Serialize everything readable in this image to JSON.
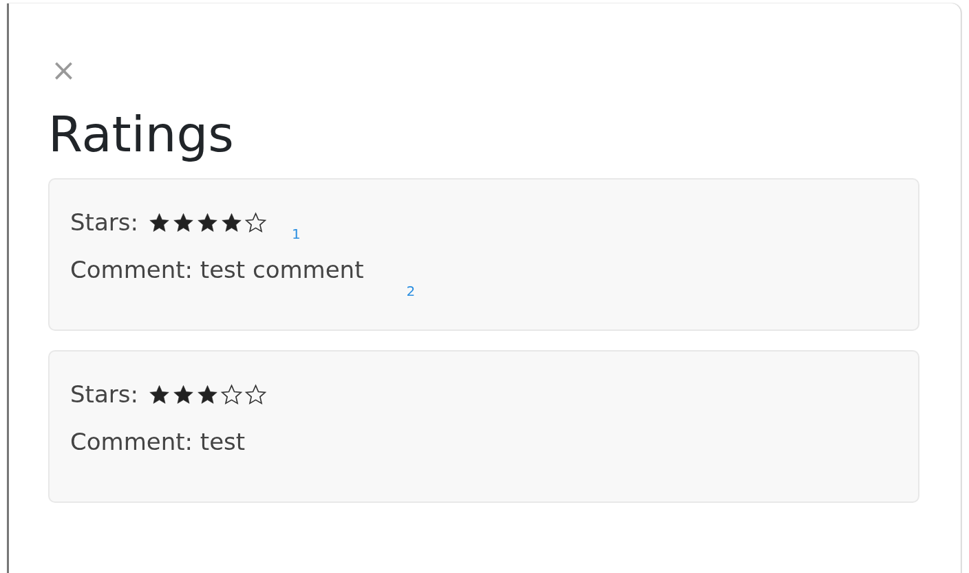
{
  "close_button": {
    "label": "×"
  },
  "title": "Ratings",
  "ratings": [
    {
      "stars_label": "Stars:",
      "stars": 4,
      "star_marker": "1",
      "comment": "Comment: test comment",
      "comment_marker": "2"
    },
    {
      "stars_label": "Stars:",
      "stars": 3,
      "comment": "Comment: test"
    }
  ]
}
